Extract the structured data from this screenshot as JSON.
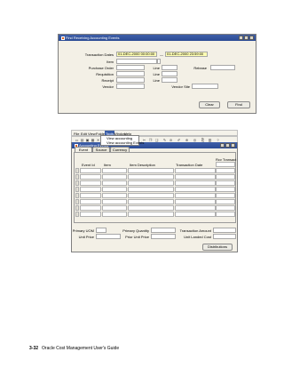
{
  "window1": {
    "title": "Find Receiving Accounting Events",
    "labels": {
      "transaction_dates": "Transaction Dates",
      "item": "Item",
      "purchase_order": "Purchase Order",
      "line1": "Line",
      "release": "Release",
      "requisition": "Requisition",
      "line2": "Line",
      "receipt": "Receipt",
      "line3": "Line",
      "vendor": "Vendor",
      "vendor_site": "Vendor Site",
      "dash": "—"
    },
    "fields": {
      "date_from": "01-DEC-2000 00:00:00",
      "date_to": "01-DEC-2000 23:59:00"
    },
    "buttons": {
      "clear": "Clear",
      "find": "Find"
    }
  },
  "window2": {
    "title": "Accounting Events",
    "menu": [
      "File",
      "Edit",
      "View",
      "Folder",
      "Tools",
      "Window",
      "Help"
    ],
    "dropdown_items": [
      "View accounting",
      "View accounting Events"
    ],
    "tabs": [
      "Event",
      "Source",
      "Currency"
    ],
    "grid_headers": {
      "event_id": "Event Id",
      "item": "Item",
      "item_description": "Item Description",
      "transaction_date": "Transaction Date",
      "rcv_transact": "Rcv Transact"
    },
    "bottom_labels": {
      "primary_uom": "Primary UOM",
      "primary_quantity": "Primary Quantity",
      "transaction_amount": "Transaction Amount",
      "unit_price": "Unit Price",
      "prior_unit_price": "Prior Unit Price",
      "unit_landed_cost": "Unit Landed Cost"
    },
    "buttons": {
      "distributions": "Distributions"
    }
  },
  "footer": {
    "page_number": "3-32",
    "guide_title": "Oracle Cost Management User's Guide"
  }
}
